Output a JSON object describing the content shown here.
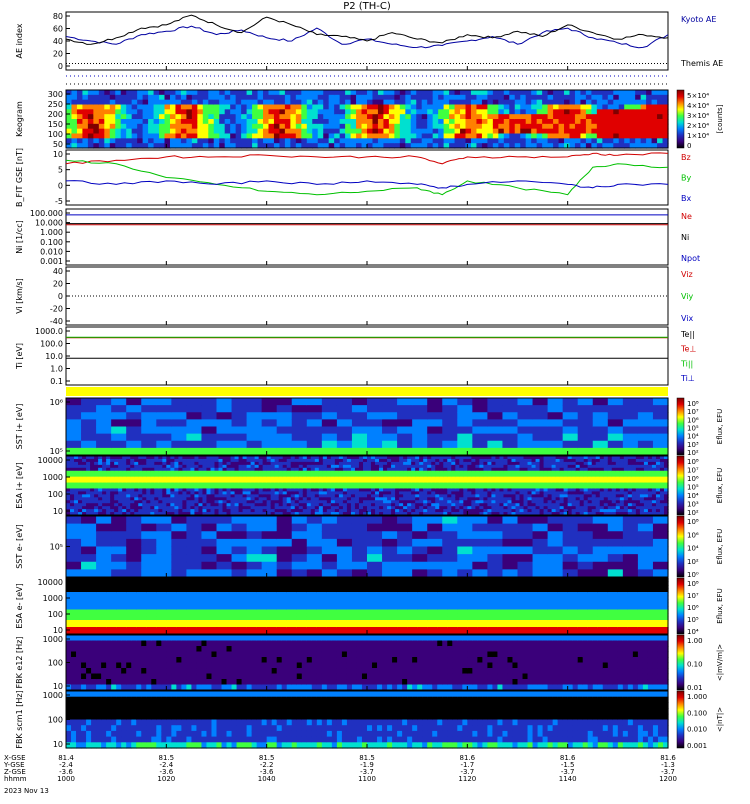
{
  "title": "P2 (TH-C)",
  "footer": {
    "row_labels": [
      "X-GSE",
      "Y-GSE",
      "Z-GSE",
      "hhmm",
      "2023 Nov 13"
    ],
    "columns": [
      {
        "x": "81.4",
        "y": "-2.4",
        "z": "-3.6",
        "t": "1000"
      },
      {
        "x": "81.5",
        "y": "-2.4",
        "z": "-3.6",
        "t": "1020"
      },
      {
        "x": "81.5",
        "y": "-2.2",
        "z": "-3.6",
        "t": "1040"
      },
      {
        "x": "81.5",
        "y": "-1.9",
        "z": "-3.7",
        "t": "1100"
      },
      {
        "x": "81.6",
        "y": "-1.7",
        "z": "-3.7",
        "t": "1120"
      },
      {
        "x": "81.6",
        "y": "-1.5",
        "z": "-3.7",
        "t": "1140"
      },
      {
        "x": "81.6",
        "y": "-1.3",
        "z": "-3.7",
        "t": "1200"
      }
    ]
  },
  "colors": {
    "red": "#d00000",
    "green": "#00c000",
    "blue": "#0000c0",
    "spectrogram": [
      "#000000",
      "#3a007a",
      "#2030c0",
      "#0080ff",
      "#00e0d0",
      "#40ff40",
      "#ffff00",
      "#ff8000",
      "#e00000",
      "#800000"
    ]
  },
  "chart_data": [
    {
      "id": "ae",
      "type": "line",
      "ylabel": "AE index",
      "ylim": [
        -10,
        80
      ],
      "ticks": [
        "80",
        "60",
        "40",
        "20",
        "0"
      ],
      "legend": [
        "Kyoto AE",
        "Themis AE"
      ],
      "series": [
        {
          "name": "Kyoto AE",
          "color": "#0000a0",
          "x": [
            1000,
            1005,
            1010,
            1015,
            1020,
            1025,
            1030,
            1035,
            1040,
            1045,
            1050,
            1055,
            1100,
            1105,
            1110,
            1115,
            1120,
            1125,
            1130,
            1135,
            1140,
            1145,
            1150,
            1155,
            1200
          ],
          "y": [
            42,
            35,
            30,
            45,
            50,
            58,
            45,
            52,
            40,
            35,
            55,
            30,
            38,
            30,
            25,
            28,
            35,
            42,
            30,
            48,
            55,
            40,
            32,
            25,
            45
          ]
        },
        {
          "name": "Themis AE",
          "color": "#000000",
          "x": [
            1000,
            1005,
            1010,
            1015,
            1020,
            1025,
            1030,
            1035,
            1040,
            1045,
            1050,
            1055,
            1100,
            1105,
            1110,
            1115,
            1120,
            1125,
            1130,
            1135,
            1140,
            1145,
            1150,
            1155,
            1200
          ],
          "y": [
            38,
            30,
            40,
            55,
            60,
            75,
            60,
            48,
            72,
            60,
            45,
            42,
            35,
            48,
            38,
            32,
            45,
            40,
            50,
            42,
            60,
            48,
            38,
            45,
            40
          ]
        }
      ]
    },
    {
      "id": "keogram",
      "type": "heatmap",
      "ylabel": "Keogram",
      "ylim": [
        50,
        300
      ],
      "ticks": [
        "300",
        "250",
        "200",
        "150",
        "100",
        "50"
      ],
      "units": "[counts]",
      "scale": [
        "5×10⁴",
        "4×10⁴",
        "3×10⁴",
        "2×10⁴",
        "1×10⁴",
        "0"
      ]
    },
    {
      "id": "bfield",
      "type": "line",
      "ylabel": "B_FIT GSE [nT]",
      "ylim": [
        -8,
        8
      ],
      "ticks": [
        "10",
        "5",
        "0",
        "-5"
      ],
      "legend": [
        "Bz",
        "By",
        "Bx"
      ],
      "series": [
        {
          "name": "Bz",
          "color": "#d00000",
          "x": [
            1000,
            1010,
            1020,
            1030,
            1040,
            1050,
            1100,
            1110,
            1115,
            1120,
            1130,
            1140,
            1145,
            1150,
            1200
          ],
          "y": [
            4,
            5,
            6,
            6,
            6.5,
            6,
            6,
            6,
            4,
            6,
            6,
            6,
            7,
            6.5,
            7
          ]
        },
        {
          "name": "By",
          "color": "#00c000",
          "x": [
            1000,
            1010,
            1020,
            1030,
            1040,
            1050,
            1100,
            1110,
            1115,
            1120,
            1130,
            1140,
            1145,
            1150,
            1200
          ],
          "y": [
            5,
            4,
            0,
            -2,
            -4,
            -5,
            -4,
            -3,
            -5,
            -1,
            -3,
            -5,
            3,
            4,
            3
          ]
        },
        {
          "name": "Bx",
          "color": "#0000c0",
          "x": [
            1000,
            1010,
            1020,
            1030,
            1040,
            1050,
            1100,
            1110,
            1115,
            1120,
            1130,
            1140,
            1145,
            1150,
            1200
          ],
          "y": [
            -1,
            -2,
            -1,
            -2,
            -1,
            -2,
            -1,
            -2,
            -3,
            -2,
            -1,
            -2,
            -3,
            -2,
            -2
          ]
        }
      ]
    },
    {
      "id": "density",
      "type": "line",
      "ylabel": "Ni [1/cc]",
      "ylim": [
        0.001,
        100
      ],
      "ticks": [
        "100.000",
        "10.000",
        "1.000",
        "0.100",
        "0.010",
        "0.001"
      ],
      "legend": [
        "Ne",
        "Ni",
        "Npot"
      ],
      "series": [
        {
          "name": "Ne",
          "color": "#d00000",
          "x": [
            1000,
            1200
          ],
          "y": [
            4,
            4
          ]
        },
        {
          "name": "Ni",
          "color": "#000000",
          "x": [
            1000,
            1200
          ],
          "y": [
            5,
            5
          ]
        },
        {
          "name": "Npot",
          "color": "#0000c0",
          "x": [
            1000,
            1200
          ],
          "y": [
            30,
            30
          ]
        }
      ]
    },
    {
      "id": "velocity",
      "type": "line",
      "ylabel": "Vi [km/s]",
      "ylim": [
        -50,
        50
      ],
      "ticks": [
        "40",
        "20",
        "0",
        "-20",
        "-40"
      ],
      "legend": [
        "Viz",
        "Viy",
        "Vix"
      ],
      "series": [
        {
          "name": "zero",
          "color": "#000000",
          "x": [
            1000,
            1200
          ],
          "y": [
            0,
            0
          ]
        }
      ]
    },
    {
      "id": "temperature",
      "type": "line",
      "ylabel": "Ti [eV]",
      "ylim": [
        0.1,
        10000
      ],
      "ticks": [
        "1000.0",
        "100.0",
        "10.0",
        "1.0",
        "0.1"
      ],
      "legend": [
        "Te||",
        "Te⊥",
        "Ti||",
        "Ti⊥"
      ],
      "series": [
        {
          "name": "Te||",
          "color": "#000000",
          "x": [
            1000,
            1200
          ],
          "y": [
            20,
            20
          ]
        },
        {
          "name": "Te⊥",
          "color": "#d00000",
          "x": [
            1000,
            1200
          ],
          "y": [
            1200,
            1200
          ]
        },
        {
          "name": "Ti||",
          "color": "#00c000",
          "x": [
            1000,
            1200
          ],
          "y": [
            1300,
            1300
          ]
        }
      ]
    },
    {
      "id": "sst_i",
      "type": "heatmap",
      "ylabel": "SST i+ [eV]",
      "ticks": [
        "10⁶",
        "10⁵"
      ],
      "cbar": [
        "10⁸",
        "10⁷",
        "10⁶",
        "10⁵",
        "10⁴",
        "10³",
        "10²"
      ],
      "cbar_label": "Eflux, EFU"
    },
    {
      "id": "esa_i",
      "type": "heatmap",
      "ylabel": "ESA i+ [eV]",
      "ticks": [
        "10000",
        "1000",
        "100",
        "10"
      ],
      "cbar": [
        "10⁸",
        "10⁷",
        "10⁶",
        "10⁵",
        "10⁴",
        "10³",
        "10²"
      ],
      "cbar_label": "Eflux, EFU"
    },
    {
      "id": "sst_e",
      "type": "heatmap",
      "ylabel": "SST e- [eV]",
      "ticks": [
        "10⁵"
      ],
      "cbar": [
        "10⁸",
        "10⁶",
        "10⁴",
        "10²",
        "10⁰"
      ],
      "cbar_label": "Eflux, EFU"
    },
    {
      "id": "esa_e",
      "type": "heatmap",
      "ylabel": "ESA e- [eV]",
      "ticks": [
        "10000",
        "1000",
        "100",
        "10"
      ],
      "cbar": [
        "10⁸",
        "10⁷",
        "10⁶",
        "10⁵",
        "10⁴"
      ],
      "cbar_label": "Eflux, EFU"
    },
    {
      "id": "fbk_e",
      "type": "heatmap",
      "ylabel": "FBK e12 [Hz]",
      "ticks": [
        "1000",
        "100",
        "10"
      ],
      "cbar": [
        "1.00",
        "0.10",
        "0.01"
      ],
      "cbar_label": "<|mV/m|>"
    },
    {
      "id": "fbk_b",
      "type": "heatmap",
      "ylabel": "FBK scm1 [Hz]",
      "ticks": [
        "1000",
        "100",
        "10"
      ],
      "cbar": [
        "1.000",
        "0.100",
        "0.010",
        "0.001"
      ],
      "cbar_label": "<|nT|>"
    }
  ]
}
